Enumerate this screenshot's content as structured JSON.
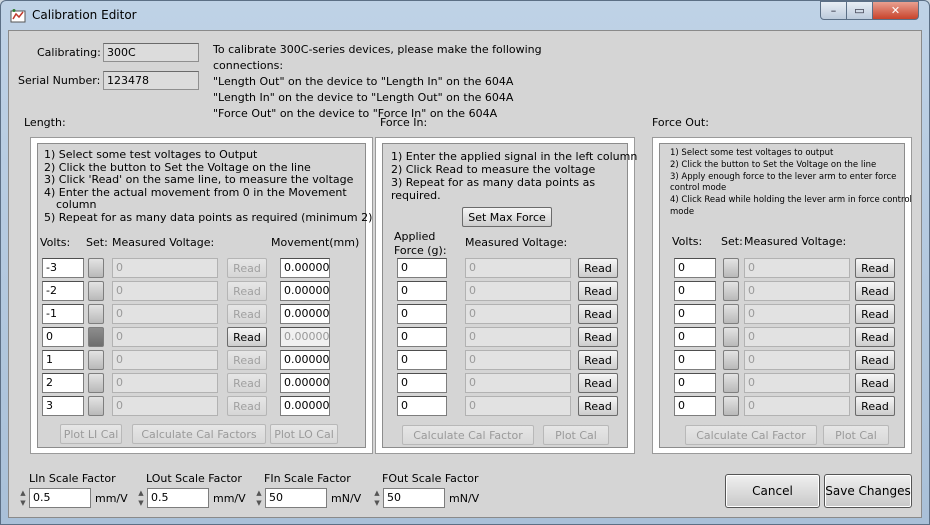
{
  "window": {
    "title": "Calibration Editor",
    "minimize": "–",
    "maximize": "▭",
    "close": "✕"
  },
  "header": {
    "calibrating_label": "Calibrating:",
    "calibrating_value": "300C",
    "serial_label": "Serial Number:",
    "serial_value": "123478",
    "instructions": [
      "To calibrate 300C-series devices, please make the following",
      "connections:",
      "\"Length Out\" on the device to \"Length In\" on the 604A",
      "\"Length In\" on the device to \"Length Out\" on the 604A",
      "\"Force Out\" on the device to \"Force In\" on the 604A"
    ]
  },
  "length": {
    "title": "Length:",
    "instructions": [
      "1) Select some test voltages to Output",
      "2) Click the button to Set the Voltage on the line",
      "3) Click 'Read' on the same line, to measure the voltage",
      "4) Enter the actual movement from 0 in the Movement",
      "column",
      "5) Repeat for as many data points as required (minimum 2)"
    ],
    "col_volts": "Volts:",
    "col_set": "Set:",
    "col_measured": "Measured Voltage:",
    "col_movement": "Movement(mm)",
    "rows": [
      {
        "volts": "-3",
        "measured": "0",
        "read": "Read",
        "movement": "0.00000"
      },
      {
        "volts": "-2",
        "measured": "0",
        "read": "Read",
        "movement": "0.00000"
      },
      {
        "volts": "-1",
        "measured": "0",
        "read": "Read",
        "movement": "0.00000"
      },
      {
        "volts": "0",
        "measured": "0",
        "read": "Read",
        "movement": "0.00000"
      },
      {
        "volts": "1",
        "measured": "0",
        "read": "Read",
        "movement": "0.00000"
      },
      {
        "volts": "2",
        "measured": "0",
        "read": "Read",
        "movement": "0.00000"
      },
      {
        "volts": "3",
        "measured": "0",
        "read": "Read",
        "movement": "0.00000"
      }
    ],
    "plot_li": "Plot LI Cal",
    "calc": "Calculate Cal Factors",
    "plot_lo": "Plot LO Cal"
  },
  "force_in": {
    "title": "Force In:",
    "instructions": [
      "1) Enter the applied signal in the left column",
      "2) Click Read to measure the voltage",
      "3) Repeat for as many data points as",
      "required."
    ],
    "set_max": "Set Max Force",
    "col_applied_1": "Applied",
    "col_applied_2": "Force (g):",
    "col_measured": "Measured Voltage:",
    "rows": [
      {
        "applied": "0",
        "measured": "0",
        "read": "Read"
      },
      {
        "applied": "0",
        "measured": "0",
        "read": "Read"
      },
      {
        "applied": "0",
        "measured": "0",
        "read": "Read"
      },
      {
        "applied": "0",
        "measured": "0",
        "read": "Read"
      },
      {
        "applied": "0",
        "measured": "0",
        "read": "Read"
      },
      {
        "applied": "0",
        "measured": "0",
        "read": "Read"
      },
      {
        "applied": "0",
        "measured": "0",
        "read": "Read"
      }
    ],
    "calc": "Calculate Cal Factor",
    "plot": "Plot Cal"
  },
  "force_out": {
    "title": "Force Out:",
    "instructions": [
      "1) Select some test voltages to output",
      "2) Click the button to Set the Voltage on the line",
      "3) Apply enough force to the lever arm to enter force",
      "control mode",
      "4) Click Read while holding the lever arm in force control",
      "mode"
    ],
    "col_volts": "Volts:",
    "col_set": "Set:",
    "col_measured": "Measured Voltage:",
    "rows": [
      {
        "volts": "0",
        "measured": "0",
        "read": "Read"
      },
      {
        "volts": "0",
        "measured": "0",
        "read": "Read"
      },
      {
        "volts": "0",
        "measured": "0",
        "read": "Read"
      },
      {
        "volts": "0",
        "measured": "0",
        "read": "Read"
      },
      {
        "volts": "0",
        "measured": "0",
        "read": "Read"
      },
      {
        "volts": "0",
        "measured": "0",
        "read": "Read"
      },
      {
        "volts": "0",
        "measured": "0",
        "read": "Read"
      }
    ],
    "calc": "Calculate Cal Factor",
    "plot": "Plot Cal"
  },
  "scales": [
    {
      "label": "LIn Scale Factor",
      "value": "0.5",
      "unit": "mm/V"
    },
    {
      "label": "LOut Scale Factor",
      "value": "0.5",
      "unit": "mm/V"
    },
    {
      "label": "FIn Scale Factor",
      "value": "50",
      "unit": "mN/V"
    },
    {
      "label": "FOut Scale Factor",
      "value": "50",
      "unit": "mN/V"
    }
  ],
  "footer": {
    "cancel": "Cancel",
    "save": "Save Changes"
  }
}
